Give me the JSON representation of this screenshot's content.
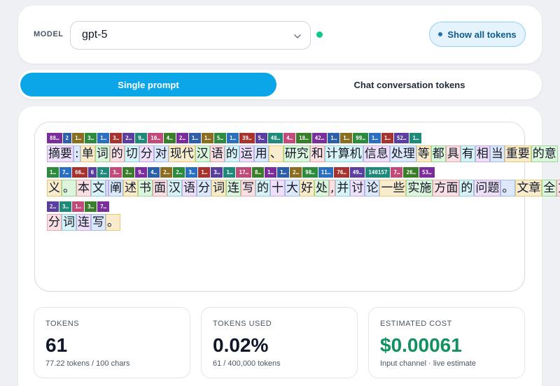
{
  "model_bar": {
    "label": "MODEL",
    "selected_model": "gpt-5",
    "show_tokens_label": "Show all tokens"
  },
  "tabs": [
    {
      "label": "Single prompt",
      "active": true
    },
    {
      "label": "Chat conversation tokens",
      "active": false
    }
  ],
  "token_viz": {
    "rows": [
      {
        "ids": [
          "88…",
          "2",
          "1…",
          "3…",
          "1…",
          "3…",
          "2…",
          "9…",
          "10…",
          "4…",
          "2…",
          "1…",
          "1…",
          "5…",
          "1…",
          "39…",
          "5…",
          "48…",
          "4…",
          "18…",
          "42…",
          "1…",
          "1…",
          "99…",
          "1…",
          "1…",
          "52…",
          "1…"
        ],
        "tokens": [
          "摘要",
          ":",
          "单",
          "词",
          "的",
          "切",
          "分",
          "对",
          "现代",
          "汉",
          "语",
          "的",
          "运",
          "用",
          "、",
          "研究",
          "和",
          "计算机",
          "信息",
          "处理",
          "等",
          "都",
          "具",
          "有",
          "相",
          "当",
          "重要",
          "的意"
        ]
      },
      {
        "ids": [
          "1…",
          "7…",
          "66…",
          "6",
          "2…",
          "3…",
          "2…",
          "9…",
          "4…",
          "2…",
          "2…",
          "3…",
          "1…",
          "3…",
          "1…",
          "17…",
          "8…",
          "1…",
          "1…",
          "2…",
          "98…",
          "11…",
          "76…",
          "49…",
          "140157",
          "7…",
          "26…",
          "53…"
        ],
        "tokens": [
          "义",
          "。",
          "本",
          "文",
          "",
          "阐",
          "述",
          "书",
          "面",
          "汉",
          "语",
          "分",
          "词",
          "连",
          "写",
          "的",
          "十",
          "大",
          "好",
          "处",
          ",",
          "并",
          "讨",
          "论",
          "一些",
          "实施",
          "方面",
          "的",
          "问题",
          "。",
          "文章",
          "全",
          "文"
        ]
      },
      {
        "ids": [
          "2…",
          "3…",
          "1…",
          "3…",
          "7…"
        ],
        "tokens": [
          "分",
          "词",
          "连",
          "写",
          "。"
        ]
      }
    ]
  },
  "stats": {
    "tokens": {
      "label": "TOKENS",
      "value": "61",
      "sub": "77.22 tokens / 100 chars"
    },
    "tokens_used": {
      "label": "TOKENS USED",
      "value": "0.02%",
      "sub": "61 / 400,000 tokens"
    },
    "estimated_cost": {
      "label": "ESTIMATED COST",
      "value": "$0.00061",
      "sub": "Input channel · live estimate"
    }
  },
  "colors": {
    "accent": "#0aa6e8",
    "status_dot": "#10c48a",
    "cost_green": "#10915f",
    "id_chip_palette": [
      "#7b2d9c",
      "#2c5fa8",
      "#8a6d1e",
      "#2e8b3d",
      "#2b6fc0",
      "#a8322d",
      "#5b3fa0",
      "#1f8a7a",
      "#c14a7a",
      "#3a7d2a"
    ],
    "token_palette": [
      {
        "bg": "#ede0f7",
        "border": "#c9a6e6"
      },
      {
        "bg": "#dde9fb",
        "border": "#9ebff0"
      },
      {
        "bg": "#f8eccd",
        "border": "#e6c877"
      },
      {
        "bg": "#dcf5dc",
        "border": "#95d995"
      },
      {
        "bg": "#fbe0e3",
        "border": "#eba6ad"
      },
      {
        "bg": "#d8f2f5",
        "border": "#8fd3dc"
      }
    ]
  },
  "icons": {
    "chevron": "chevron-down-icon",
    "status": "status-dot-icon"
  }
}
